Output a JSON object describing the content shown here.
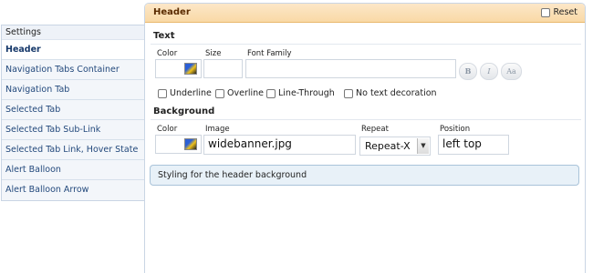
{
  "sidebar": {
    "header": "Settings",
    "items": [
      {
        "label": "Header"
      },
      {
        "label": "Navigation Tabs Container"
      },
      {
        "label": "Navigation Tab"
      },
      {
        "label": "Selected Tab"
      },
      {
        "label": "Selected Tab Sub-Link"
      },
      {
        "label": "Selected Tab Link, Hover State"
      },
      {
        "label": "Alert Balloon"
      },
      {
        "label": "Alert Balloon Arrow"
      }
    ],
    "active_index": 0
  },
  "panel": {
    "title": "Header",
    "reset_label": "Reset",
    "reset_checked": false
  },
  "text_section": {
    "title": "Text",
    "color_label": "Color",
    "size_label": "Size",
    "font_family_label": "Font Family",
    "size_value": "",
    "font_family_value": "",
    "bold_glyph": "B",
    "italic_glyph": "I",
    "case_glyph": "Aa",
    "decorations": [
      {
        "label": "Underline",
        "checked": false
      },
      {
        "label": "Overline",
        "checked": false
      },
      {
        "label": "Line-Through",
        "checked": false
      },
      {
        "label": "No text decoration",
        "checked": false
      }
    ]
  },
  "background_section": {
    "title": "Background",
    "color_label": "Color",
    "image_label": "Image",
    "repeat_label": "Repeat",
    "position_label": "Position",
    "image_value": "widebanner.jpg",
    "repeat_value": "Repeat-X",
    "position_value": "left top"
  },
  "description": "Styling for the header background",
  "icons": {
    "color_picker": "color-picker-icon",
    "dropdown": "chevron-down-icon",
    "checkbox": "checkbox-icon"
  },
  "colors": {
    "header_gradient_top": "#fce7c8",
    "header_gradient_bottom": "#f9d9a6",
    "link": "#23497c",
    "description_bg": "#e8f1f8"
  }
}
